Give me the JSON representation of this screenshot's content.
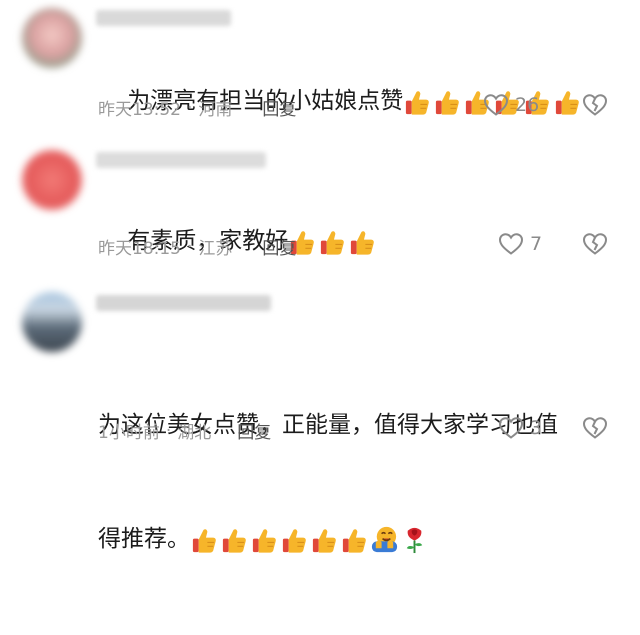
{
  "comments": [
    {
      "text": "为漂亮有担当的小姑娘点赞",
      "time": "昨天13:52",
      "location": "河南",
      "reply_label": "回复",
      "likes": "26",
      "thumbs_count": 6,
      "avatar_color": "#e8a7a7"
    },
    {
      "text": "有素质，家教好",
      "time": "昨天18:15",
      "location": "江苏",
      "reply_label": "回复",
      "likes": "7",
      "thumbs_count": 3,
      "avatar_color": "#e55b5b"
    },
    {
      "text_line1": "为这位美女点赞，正能量，值得大家学习也值",
      "text_line2": "得推荐。",
      "time": "1小时前",
      "location": "湖北",
      "reply_label": "回复",
      "likes": "3",
      "thumbs_count": 6,
      "extra_emojis": [
        "hugging-face",
        "rose"
      ],
      "avatar_color": "#7b8da3"
    }
  ],
  "separator": "·",
  "colors": {
    "thumb_yellow": "#f6b52a",
    "thumb_cuff": "#e0483a",
    "meta_gray": "#9a9a9a",
    "icon_gray": "#8a8a8a"
  }
}
